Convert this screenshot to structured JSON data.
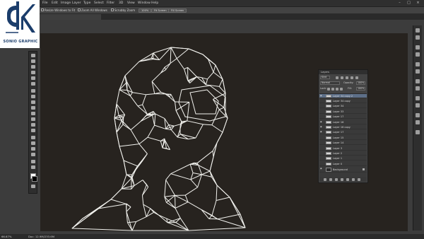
{
  "menubar": {
    "items": [
      "File",
      "Edit",
      "Image",
      "Layer",
      "Type",
      "Select",
      "Filter",
      "3D",
      "View",
      "Window",
      "Help"
    ],
    "window_controls": [
      "–",
      "□",
      "×"
    ]
  },
  "options_bar": {
    "resize_label": "Resize Windows to Fit",
    "zoom_all_label": "Zoom All Windows",
    "scrubby_label": "Scrubby Zoom",
    "btn_100": "100%",
    "btn_fit": "Fit Screen",
    "btn_fill": "Fill Screen"
  },
  "document": {
    "tab_label": ""
  },
  "logo": {
    "brand": "SONIO GRAPHIC"
  },
  "layers_panel": {
    "title": "Layers",
    "kind_label": "Kind",
    "blend_mode": "Normal",
    "opacity_label": "Opacity:",
    "opacity_value": "100%",
    "lock_label": "Lock:",
    "fill_label": "Fill:",
    "fill_value": "100%",
    "layers": [
      {
        "name": "Layer 34 copy 2",
        "selected": true
      },
      {
        "name": "Layer 34 copy",
        "selected": false
      },
      {
        "name": "Layer 34",
        "selected": false
      },
      {
        "name": "Layer 33",
        "selected": false
      },
      {
        "name": "Layer 17",
        "selected": false
      },
      {
        "name": "Layer 16",
        "selected": false
      },
      {
        "name": "Layer 16 copy",
        "selected": false
      },
      {
        "name": "Layer 17",
        "selected": false
      },
      {
        "name": "Layer 15",
        "selected": false
      },
      {
        "name": "Layer 14",
        "selected": false
      },
      {
        "name": "Layer 3",
        "selected": false
      },
      {
        "name": "Layer 2",
        "selected": false
      },
      {
        "name": "Layer 1",
        "selected": false
      },
      {
        "name": "Layer 0",
        "selected": false
      },
      {
        "name": "Background",
        "selected": false,
        "locked": true
      }
    ]
  },
  "status_bar": {
    "zoom": "66.67%",
    "doc_size": "Doc: 12.9M/233.6M"
  },
  "colors": {
    "canvas_bg": "#27231f",
    "mesh_stroke": "#f2f2ee",
    "panel_bg": "#434343",
    "selected_layer": "#5d6f88",
    "brand": "#1b3d6b"
  }
}
